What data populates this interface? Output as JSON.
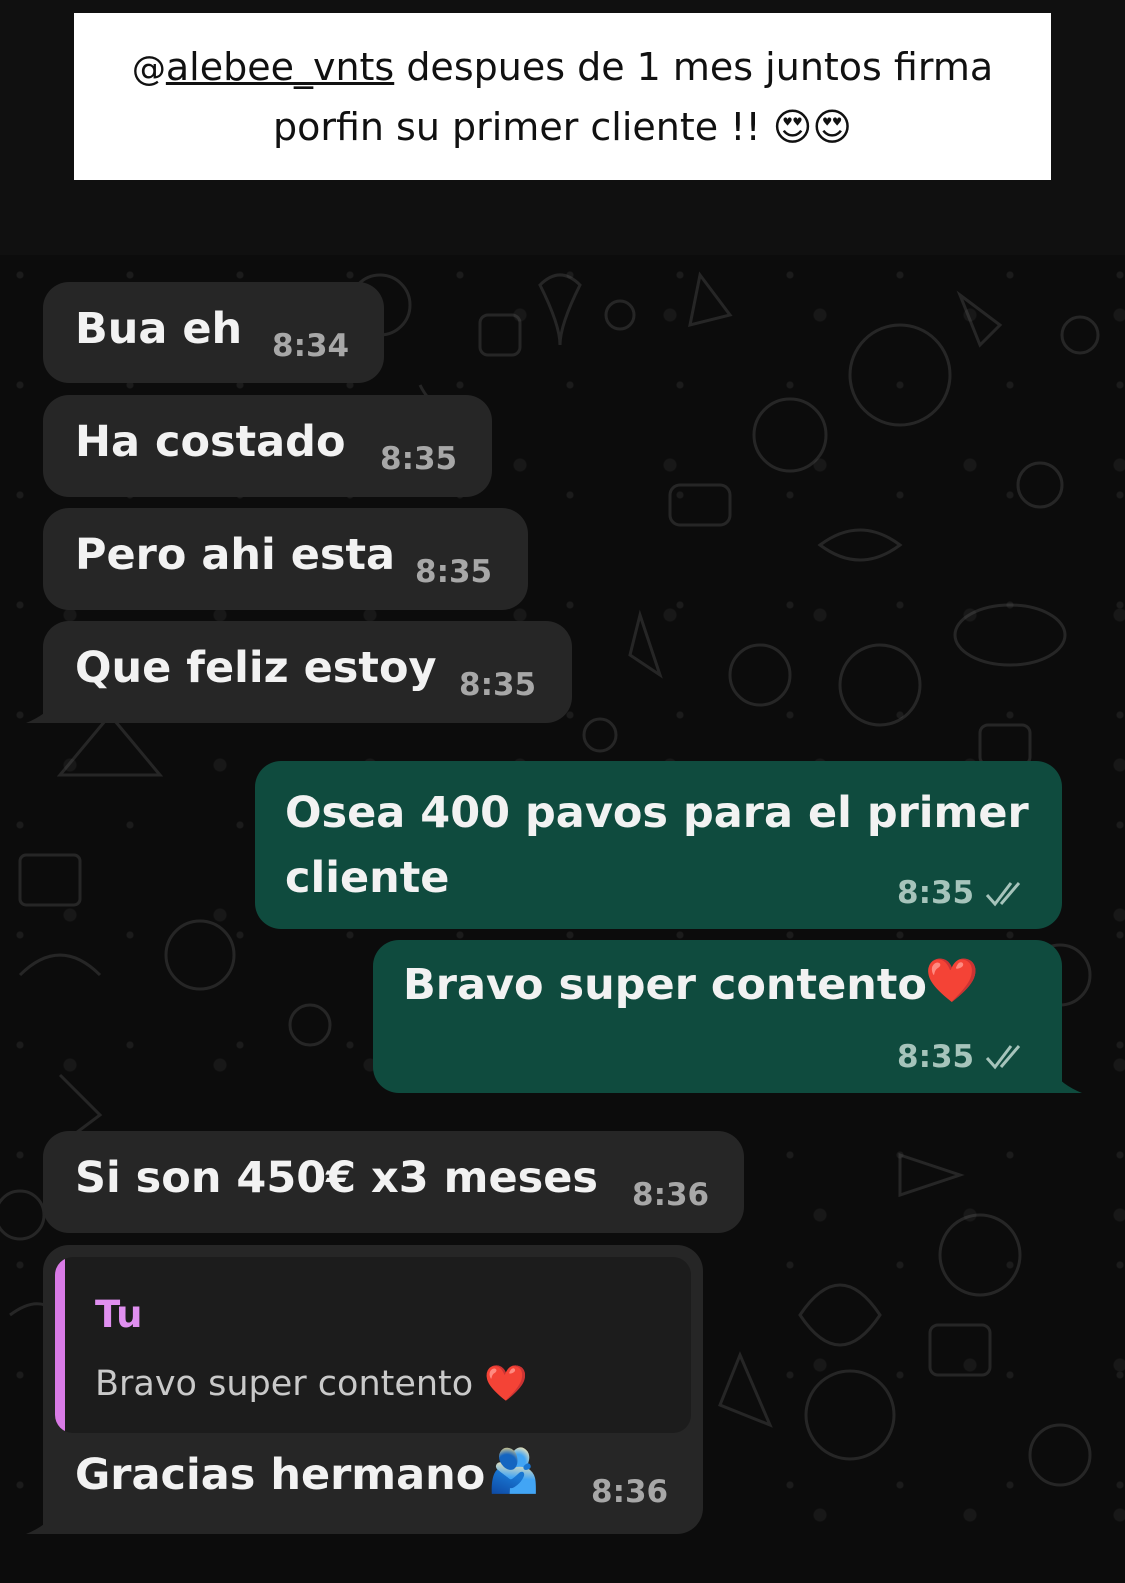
{
  "caption": {
    "mention": "alebee_vnts",
    "line1_rest": " despues de 1 mes juntos firma",
    "line2": "porfin su primer cliente !! 😍😍"
  },
  "messages": [
    {
      "text": "Bua eh",
      "time": "8:34",
      "direction": "incoming"
    },
    {
      "text": "Ha costado",
      "time": "8:35",
      "direction": "incoming"
    },
    {
      "text": "Pero ahi esta",
      "time": "8:35",
      "direction": "incoming"
    },
    {
      "text": "Que feliz estoy",
      "time": "8:35",
      "direction": "incoming"
    },
    {
      "text_line1": "Osea 400 pavos para el primer",
      "text_line2": "cliente",
      "time": "8:35",
      "direction": "outgoing",
      "status": "read"
    },
    {
      "text": "Bravo super contento",
      "emoji": "❤️",
      "time": "8:35",
      "direction": "outgoing",
      "status": "read"
    },
    {
      "text": "Si son 450€ x3 meses",
      "time": "8:36",
      "direction": "incoming"
    },
    {
      "quote_author": "Tu",
      "quote_text": "Bravo super contento",
      "quote_emoji": "❤️",
      "text": "Gracias hermano",
      "emoji": "🫂",
      "time": "8:36",
      "direction": "incoming"
    }
  ],
  "colors": {
    "incoming_bubble": "#262626",
    "outgoing_bubble": "#0f4b3e",
    "quote_accent": "#d97be6",
    "background": "#0c0c0c"
  }
}
